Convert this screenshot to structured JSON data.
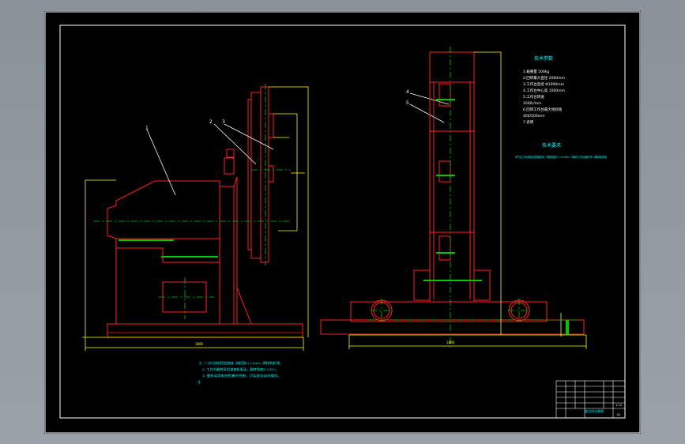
{
  "labels": {
    "part_1": "1",
    "part_2": "2",
    "part_3": "3",
    "part_4": "4",
    "part_5": "5"
  },
  "tech_params": {
    "title": "技术参数",
    "lines": [
      "1.载重量 500kg",
      "2.回转最大直径 2000mm",
      "3.工作台直径 Φ1000mm",
      "4.工作台中心高 1000mm",
      "5.工作台转速",
      "1000r/min",
      "6.回转工作台最大倾斜角",
      "400/500mm",
      "7.说明"
    ]
  },
  "tech_req": {
    "title": "技术要求",
    "text": "本产品工作台转速由变频器控制，调速范围在0.1-1.0r/min，焊接时工作台速度可调，确保焊缝质量"
  },
  "notes": {
    "lines": [
      "注：1. 工作台回转采用变频调速，调速范围0.1-1.0r/min，焊接时转速可调。",
      "2. 工作台翻转采用减速机驱动，翻转角度0-135°。",
      "3. 整机采用电控柜集中控制，可实现自动化操作。"
    ],
    "tail": "注"
  },
  "dimensions": {
    "left_width": "1800",
    "right_width": "1800"
  },
  "title_block": {
    "drawing_name": "变位机总装图",
    "scale": "1:10",
    "sheet": "A1"
  },
  "colors": {
    "background": "#000000",
    "outline": "#ff2020",
    "center_lines": "#00c800",
    "dimensions": "#ffff00",
    "annotations": "#00ffff",
    "frame": "#ffffff",
    "window": "#8d949d"
  }
}
